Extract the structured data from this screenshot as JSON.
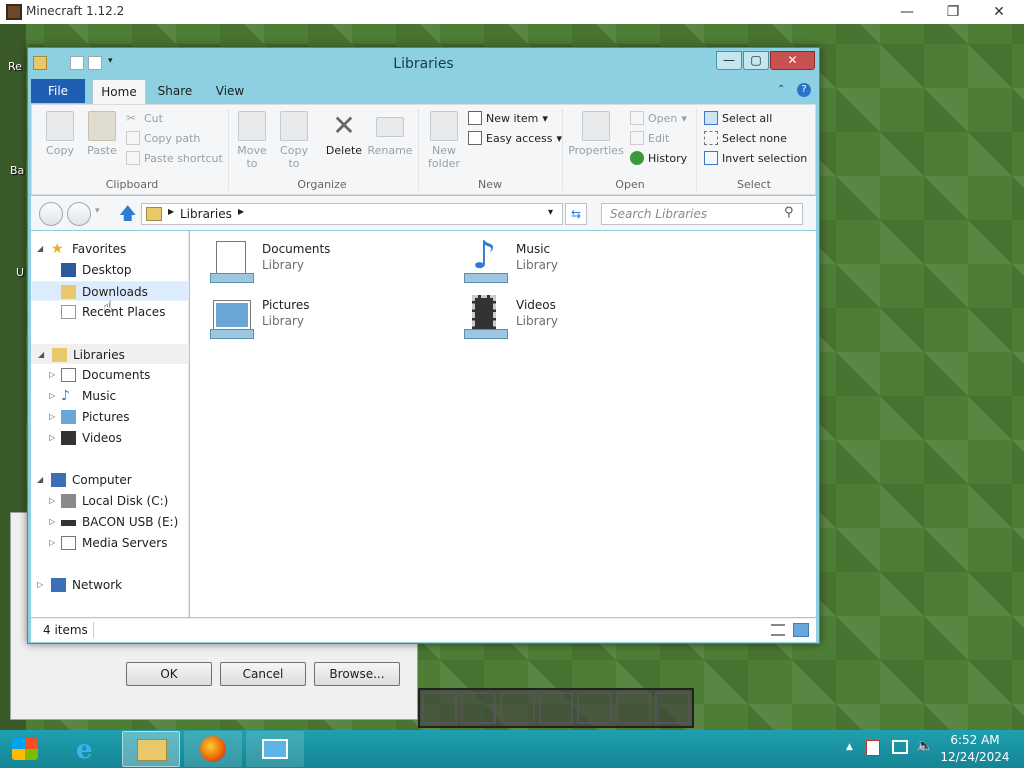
{
  "outer_window": {
    "title": "Minecraft 1.12.2",
    "min": "—",
    "max": "❐",
    "close": "✕"
  },
  "desktop": {
    "label1": "Re",
    "label2": "Ba",
    "label3": "U"
  },
  "dialog": {
    "ok": "OK",
    "cancel": "Cancel",
    "browse": "Browse..."
  },
  "explorer": {
    "title": "Libraries",
    "controls": {
      "min": "—",
      "max": "▢",
      "close": "✕"
    },
    "tabs": {
      "file": "File",
      "home": "Home",
      "share": "Share",
      "view": "View"
    },
    "ribbon": {
      "clipboard": {
        "label": "Clipboard",
        "copy": "Copy",
        "paste": "Paste",
        "cut": "Cut",
        "copy_path": "Copy path",
        "paste_shortcut": "Paste shortcut"
      },
      "organize": {
        "label": "Organize",
        "move_to": "Move to",
        "copy_to": "Copy to",
        "delete": "Delete",
        "rename": "Rename"
      },
      "new": {
        "label": "New",
        "new_folder": "New folder",
        "new_item": "New item",
        "easy_access": "Easy access"
      },
      "open": {
        "label": "Open",
        "properties": "Properties",
        "open": "Open",
        "edit": "Edit",
        "history": "History"
      },
      "select": {
        "label": "Select",
        "select_all": "Select all",
        "select_none": "Select none",
        "invert_selection": "Invert selection"
      }
    },
    "address": {
      "path": "Libraries",
      "search_placeholder": "Search Libraries"
    },
    "nav": {
      "favorites": "Favorites",
      "desktop": "Desktop",
      "downloads": "Downloads",
      "recent": "Recent Places",
      "libraries": "Libraries",
      "documents": "Documents",
      "music": "Music",
      "pictures": "Pictures",
      "videos": "Videos",
      "computer": "Computer",
      "local_disk": "Local Disk (C:)",
      "usb": "BACON USB (E:)",
      "media_servers": "Media Servers",
      "network": "Network"
    },
    "items": [
      {
        "name": "Documents",
        "type": "Library"
      },
      {
        "name": "Music",
        "type": "Library"
      },
      {
        "name": "Pictures",
        "type": "Library"
      },
      {
        "name": "Videos",
        "type": "Library"
      }
    ],
    "status": {
      "count": "4 items"
    }
  },
  "taskbar": {
    "time": "6:52 AM",
    "date": "12/24/2024",
    "tray_up": "▲"
  },
  "colors": {
    "accent": "#1e5fb3",
    "window_frame": "#8cd0e2",
    "taskbar": "#1fa0b0",
    "selection": "#dcecfc"
  }
}
